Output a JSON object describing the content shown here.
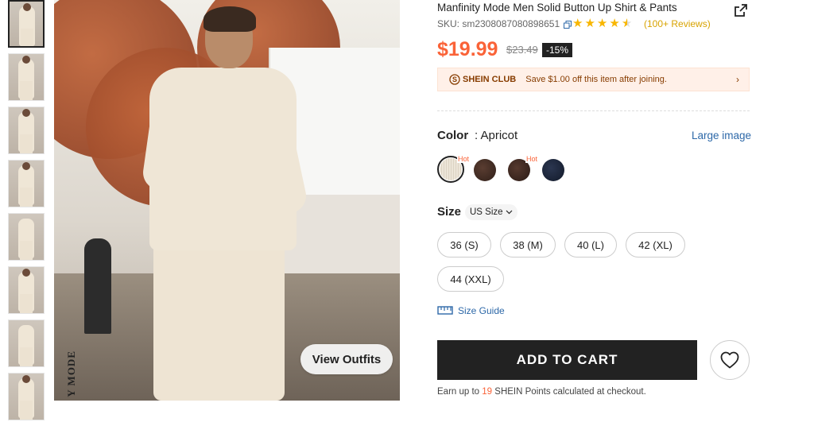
{
  "product": {
    "title": "Manfinity Mode Men Solid Button Up Shirt & Pants",
    "sku": "SKU: sm2308087080898651",
    "rating": 4.5,
    "reviews": "(100+ Reviews)",
    "price": "$19.99",
    "original_price": "$23.49",
    "discount": "-15%"
  },
  "club": {
    "badge": "SHEIN CLUB",
    "text": "Save $1.00 off this item after joining.",
    "arrow": "›"
  },
  "color": {
    "label": "Color",
    "value": ": Apricot",
    "large_image": "Large image",
    "hot_label": "Hot",
    "swatches": [
      {
        "name": "apricot",
        "color": "#e9e2d4",
        "hot": true,
        "selected": true
      },
      {
        "name": "brown",
        "color": "#3f2a22",
        "hot": false,
        "selected": false
      },
      {
        "name": "dark-brown",
        "color": "#3a2520",
        "hot": true,
        "selected": false
      },
      {
        "name": "navy",
        "color": "#1b2436",
        "hot": false,
        "selected": false
      }
    ]
  },
  "size": {
    "label": "Size",
    "system": "US Size",
    "options": [
      "36 (S)",
      "38 (M)",
      "40 (L)",
      "42 (XL)",
      "44 (XXL)"
    ],
    "guide": "Size Guide"
  },
  "gallery": {
    "view_outfits": "View Outfits",
    "vertical_text": "Y MODE",
    "thumbnail_count": 8
  },
  "actions": {
    "add_to_cart": "ADD TO CART"
  },
  "points": {
    "prefix": "Earn up to",
    "number": "19",
    "suffix": "SHEIN Points calculated at checkout."
  },
  "colors": {
    "accent": "#fa6338",
    "link": "#2d68a8",
    "star": "#f8b600"
  }
}
